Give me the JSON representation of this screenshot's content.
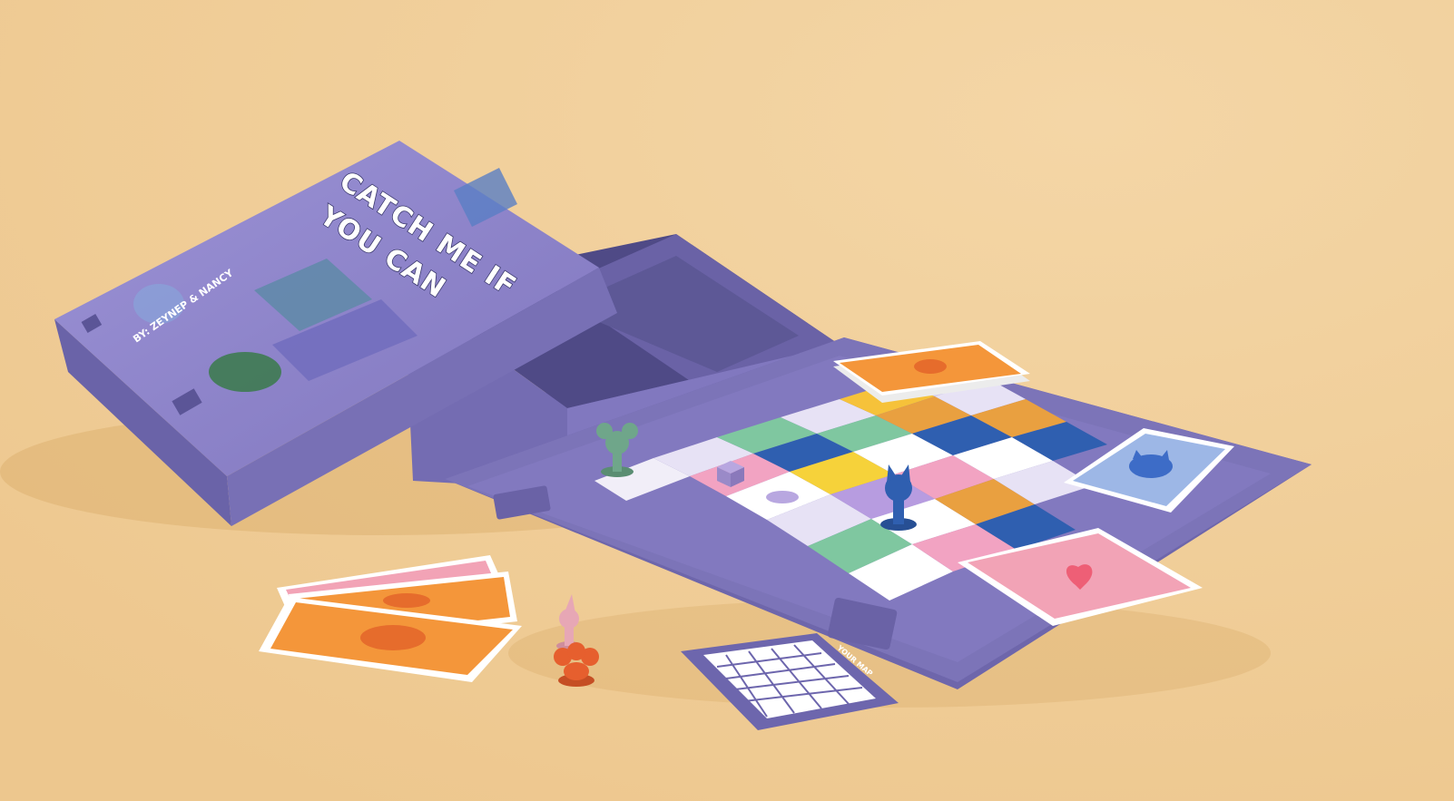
{
  "game": {
    "title_line1": "CATCH ME IF",
    "title_line2": "YOU CAN",
    "credit": "BY: ZEYNEP & NANCY",
    "grid_card_label": "YOUR MAP"
  },
  "colors": {
    "table": "#f0cf9a",
    "box_purple": "#7c74b8",
    "box_dark": "#5d5894",
    "board_purple": "#7a72b5",
    "card_orange": "#f4963a",
    "card_pink": "#f2a3b6",
    "card_blue": "#9db7e6",
    "pawn_green": "#6fa68a",
    "pawn_blue": "#2f5fb0",
    "pawn_pink": "#e7a7b5",
    "pawn_orange": "#e65f2e"
  },
  "icons": {
    "orange_cards": "mouse-silhouette-icon",
    "blue_card": "cat-head-icon",
    "pink_card": "heart-icon"
  }
}
